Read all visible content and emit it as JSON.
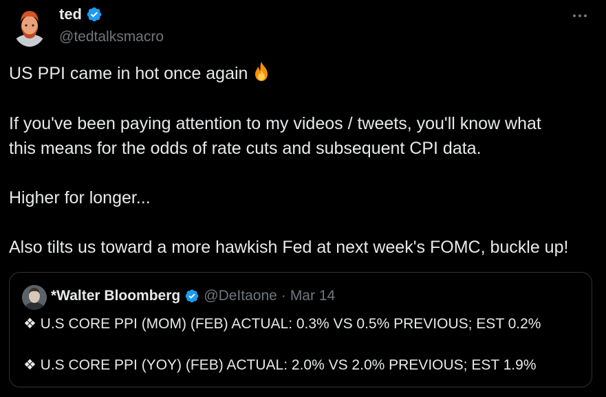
{
  "tweet": {
    "author": {
      "name": "ted",
      "handle": "@tedtalksmacro",
      "verified": true
    },
    "body_lines": [
      "US PPI came in hot once again",
      "If you've been paying attention to my videos / tweets, you'll know what",
      "this means for the odds of rate cuts and subsequent CPI data.",
      "Higher for longer...",
      "Also tilts us toward a more hawkish Fed at next week's FOMC, buckle up!"
    ],
    "emoji": "fire-icon"
  },
  "quote": {
    "name": "*Walter Bloomberg",
    "handle": "@DeItaone",
    "separator": "·",
    "date": "Mar 14",
    "lines": [
      "❖ U.S CORE PPI (MOM) (FEB) ACTUAL: 0.3% VS 0.5% PREVIOUS; EST 0.2%",
      "❖ U.S CORE PPI (YOY) (FEB) ACTUAL: 2.0% VS 2.0% PREVIOUS; EST 1.9%"
    ]
  },
  "colors": {
    "background": "#000000",
    "text": "#e7e9ea",
    "muted": "#71767b",
    "verified": "#1d9bf0",
    "border": "#2f3336"
  }
}
